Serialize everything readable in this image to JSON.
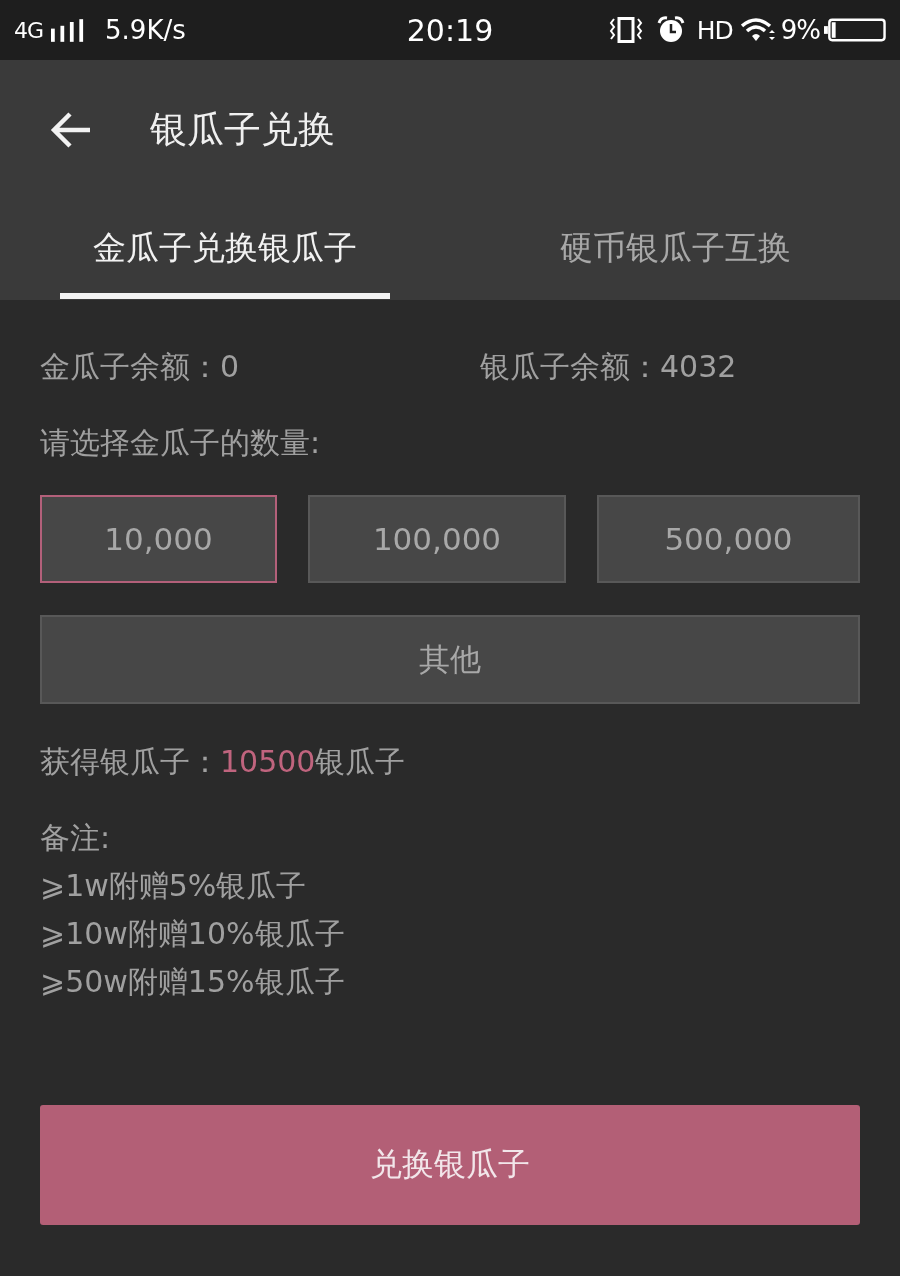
{
  "status_bar": {
    "network": "4G",
    "speed": "5.9K/s",
    "time": "20:19",
    "hd": "HD",
    "battery": "9%"
  },
  "app_bar": {
    "title": "银瓜子兑换"
  },
  "tabs": [
    {
      "label": "金瓜子兑换银瓜子",
      "selected": true
    },
    {
      "label": "硬币银瓜子互换",
      "selected": false
    }
  ],
  "balances": [
    "金瓜子余额：0",
    "银瓜子余额：4032"
  ],
  "prompt": "请选择金瓜子的数量:",
  "amounts": [
    {
      "label": "10,000",
      "selected": true
    },
    {
      "label": "100,000",
      "selected": false
    },
    {
      "label": "500,000",
      "selected": false
    }
  ],
  "other_option": {
    "label": "其他",
    "selected": false
  },
  "result": {
    "label": "获得银瓜子：",
    "amount": "10500",
    "unit": "银瓜子"
  },
  "notes": {
    "title": "备注:",
    "lines": [
      "⩾1w附赠5%银瓜子",
      "⩾10w附赠10%银瓜子",
      "⩾50w附赠15%银瓜子"
    ]
  },
  "submit_button": "兑换银瓜子"
}
